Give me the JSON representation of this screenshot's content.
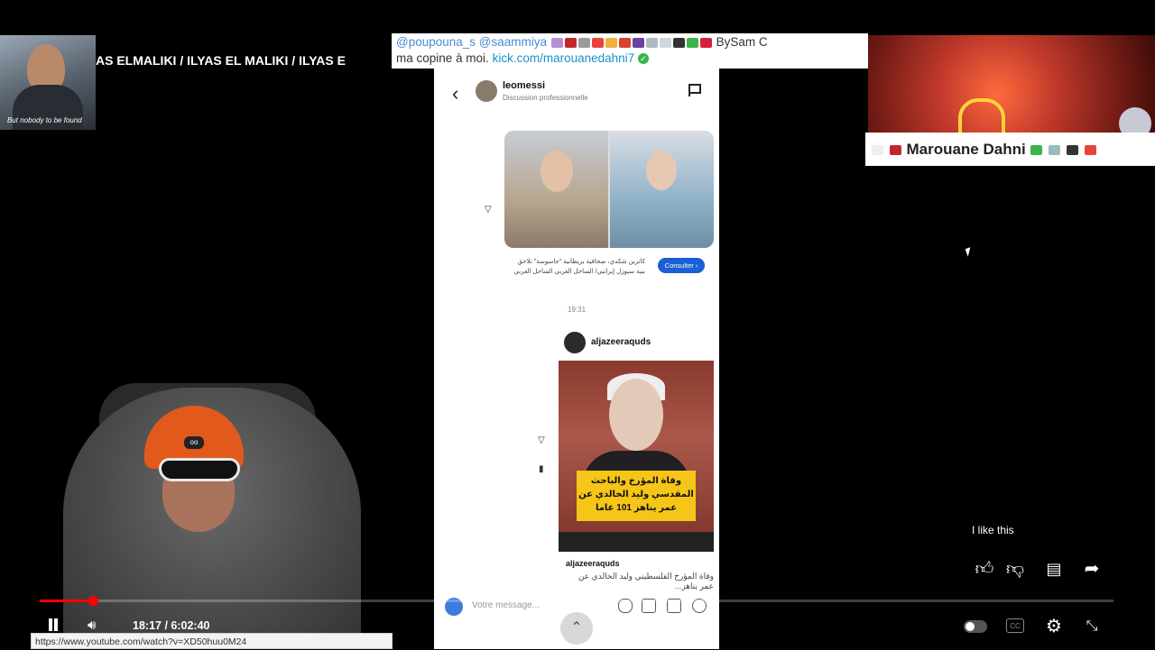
{
  "overlay": {
    "thumb_caption": "But nobody to be found",
    "marquee": "AS ELMALIKI / ILYAS EL MALIKI / ILYAS E",
    "ticker_mention1": "@poupouna_s",
    "ticker_mention2": "@saammiya",
    "ticker_suffix": "BySam C",
    "ticker_line2_text": "ma copine à moi.",
    "ticker_link": "kick.com/marouanedahni7",
    "promo_name": "Marouane Dahni",
    "emoji_colors": [
      "#b58fd8",
      "#c1272d",
      "#9b9b9b",
      "#e8443a",
      "#f0b23c",
      "#d9412b",
      "#6b3fa0",
      "#b0b8c4",
      "#cfd6de",
      "#333",
      "#3bb54a",
      "#d61f3a"
    ]
  },
  "phone": {
    "username": "leomessi",
    "subtitle": "Discussion professionnelle",
    "arabic_caption": "كاترين شكدي، صحافية بريطانية \"جاسوسة\" تلاحق بنية سيوزل إيرانيي/ الساحل الغربي الساحل الغربي",
    "consult_label": "Consulter ›",
    "timestamp": "19:31",
    "card_user": "aljazeeraquds",
    "card_headline": "وفاة المؤرخ والباحث المقدسي وليد الخالدي عن عمر يناهز 101 عاما",
    "card_caption_user": "aljazeeraquds",
    "card_caption_text": "وفاة المؤرخ الفلسطيني وليد الخالدي عن عمر يناهز...",
    "composer_placeholder": "Votre message..."
  },
  "player": {
    "like_tooltip": "I like this",
    "time": "18:17 / 6:02:40",
    "status_url": "https://www.youtube.com/watch?v=XD50huu0M24",
    "progress_fraction": 0.0029,
    "cc_label": "CC"
  }
}
